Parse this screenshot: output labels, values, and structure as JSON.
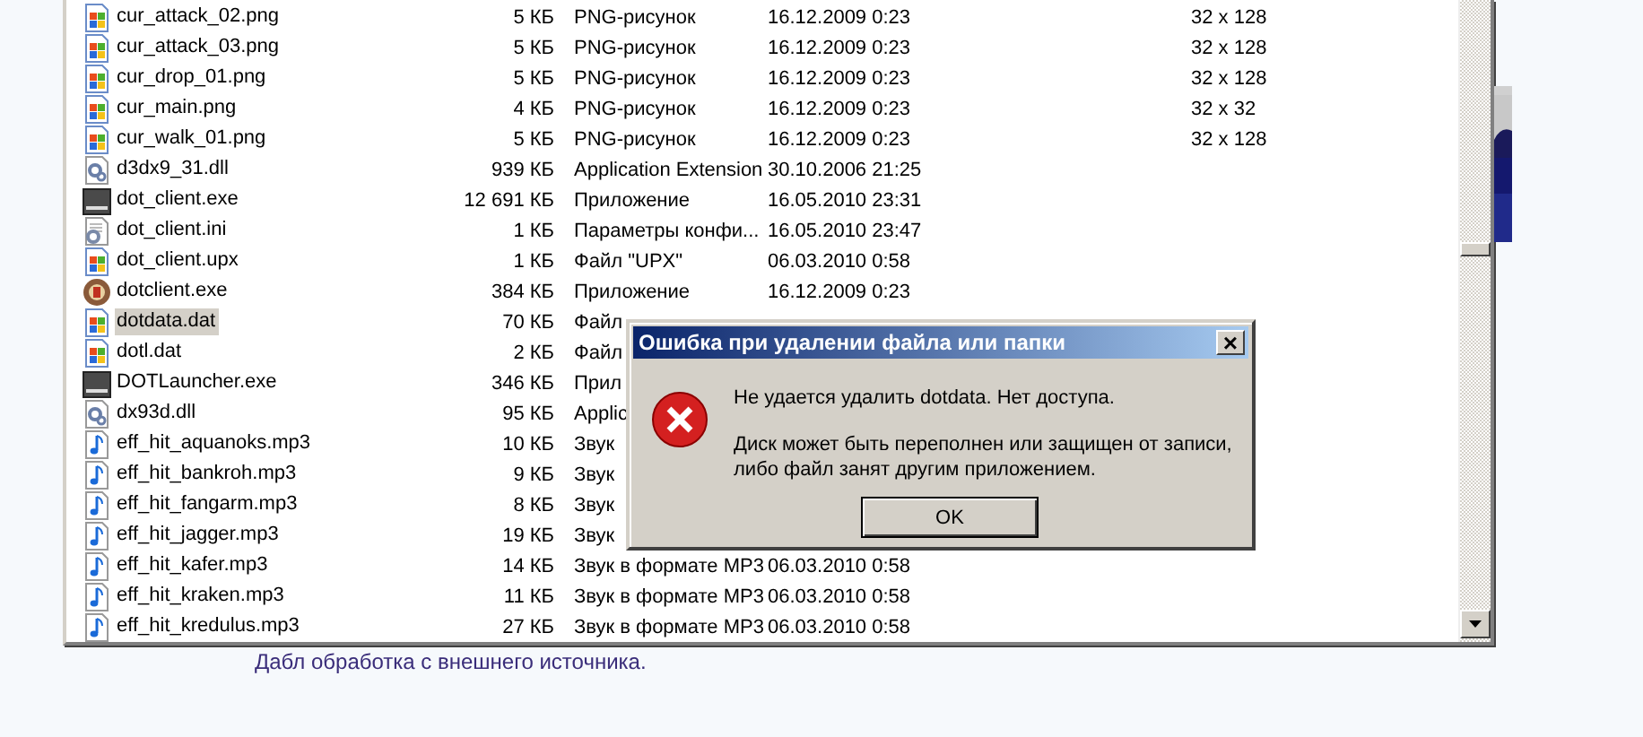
{
  "file_list": {
    "rows": [
      {
        "kind": "png",
        "name": "cur_attack_02.png",
        "size": "5 КБ",
        "type": "PNG-рисунок",
        "date": "16.12.2009 0:23",
        "dimensions": "32 x 128",
        "selected": false
      },
      {
        "kind": "png",
        "name": "cur_attack_03.png",
        "size": "5 КБ",
        "type": "PNG-рисунок",
        "date": "16.12.2009 0:23",
        "dimensions": "32 x 128",
        "selected": false
      },
      {
        "kind": "png",
        "name": "cur_drop_01.png",
        "size": "5 КБ",
        "type": "PNG-рисунок",
        "date": "16.12.2009 0:23",
        "dimensions": "32 x 128",
        "selected": false
      },
      {
        "kind": "png",
        "name": "cur_main.png",
        "size": "4 КБ",
        "type": "PNG-рисунок",
        "date": "16.12.2009 0:23",
        "dimensions": "32 x 32",
        "selected": false
      },
      {
        "kind": "png",
        "name": "cur_walk_01.png",
        "size": "5 КБ",
        "type": "PNG-рисунок",
        "date": "16.12.2009 0:23",
        "dimensions": "32 x 128",
        "selected": false
      },
      {
        "kind": "dll",
        "name": "d3dx9_31.dll",
        "size": "939 КБ",
        "type": "Application Extension",
        "date": "30.10.2006 21:25",
        "selected": false
      },
      {
        "kind": "dot",
        "name": "dot_client.exe",
        "size": "12 691 КБ",
        "type": "Приложение",
        "date": "16.05.2010 23:31",
        "selected": false
      },
      {
        "kind": "ini",
        "name": "dot_client.ini",
        "size": "1 КБ",
        "type": "Параметры конфи...",
        "date": "16.05.2010 23:47",
        "selected": false
      },
      {
        "kind": "png",
        "name": "dot_client.upx",
        "size": "1 КБ",
        "type": "Файл \"UPX\"",
        "date": "06.03.2010 0:58",
        "selected": false
      },
      {
        "kind": "round",
        "name": "dotclient.exe",
        "size": "384 КБ",
        "type": "Приложение",
        "date": "16.12.2009 0:23",
        "selected": false
      },
      {
        "kind": "png",
        "name": "dotdata.dat",
        "size": "70 КБ",
        "type": "Файл",
        "selected": true
      },
      {
        "kind": "png",
        "name": "dotl.dat",
        "size": "2 КБ",
        "type": "Файл",
        "selected": false
      },
      {
        "kind": "dot",
        "name": "DOTLauncher.exe",
        "size": "346 КБ",
        "type": "Прил",
        "selected": false
      },
      {
        "kind": "dll",
        "name": "dx93d.dll",
        "size": "95 КБ",
        "type": "Applic",
        "selected": false
      },
      {
        "kind": "mp3",
        "name": "eff_hit_aquanoks.mp3",
        "size": "10 КБ",
        "type": "Звук",
        "selected": false
      },
      {
        "kind": "mp3",
        "name": "eff_hit_bankroh.mp3",
        "size": "9 КБ",
        "type": "Звук",
        "selected": false
      },
      {
        "kind": "mp3",
        "name": "eff_hit_fangarm.mp3",
        "size": "8 КБ",
        "type": "Звук",
        "selected": false
      },
      {
        "kind": "mp3",
        "name": "eff_hit_jagger.mp3",
        "size": "19 КБ",
        "type": "Звук",
        "selected": false
      },
      {
        "kind": "mp3",
        "name": "eff_hit_kafer.mp3",
        "size": "14 КБ",
        "type": "Звук в формате MP3",
        "date": "06.03.2010 0:58",
        "selected": false
      },
      {
        "kind": "mp3",
        "name": "eff_hit_kraken.mp3",
        "size": "11 КБ",
        "type": "Звук в формате MP3",
        "date": "06.03.2010 0:58",
        "selected": false
      },
      {
        "kind": "mp3",
        "name": "eff_hit_kredulus.mp3",
        "size": "27 КБ",
        "type": "Звук в формате MP3",
        "date": "06.03.2010 0:58",
        "selected": false
      }
    ]
  },
  "dialog": {
    "title": "Ошибка при удалении файла или папки",
    "close": "×",
    "message": "Не удается удалить dotdata. Нет доступа.",
    "details": "Диск может быть переполнен или защищен от записи, либо файл занят другим приложением.",
    "button": "OK"
  },
  "caption": "Дабл обработка с внешнего источника."
}
